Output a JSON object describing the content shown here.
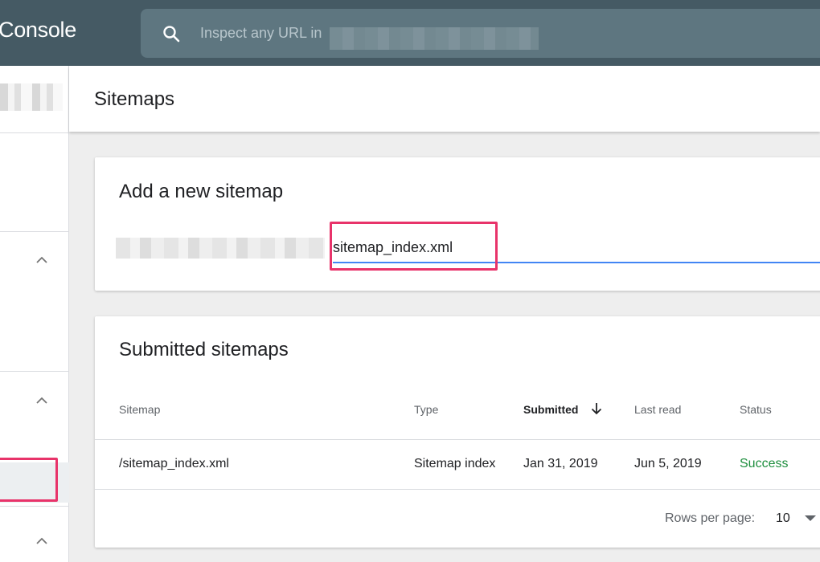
{
  "header": {
    "brand": "Console",
    "search_placeholder": "Inspect any URL in"
  },
  "page": {
    "title": "Sitemaps"
  },
  "add_sitemap": {
    "title": "Add a new sitemap",
    "input_value": "sitemap_index.xml"
  },
  "submitted": {
    "title": "Submitted sitemaps",
    "columns": {
      "sitemap": "Sitemap",
      "type": "Type",
      "submitted": "Submitted",
      "last_read": "Last read",
      "status": "Status"
    },
    "rows": [
      {
        "sitemap": "/sitemap_index.xml",
        "type": "Sitemap index",
        "submitted": "Jan 31, 2019",
        "last_read": "Jun 5, 2019",
        "status": "Success"
      }
    ],
    "footer": {
      "rows_per_page_label": "Rows per page:",
      "rows_per_page_value": "10"
    }
  },
  "colors": {
    "topbar": "#455a64",
    "accent_blue": "#4285f4",
    "success_green": "#1e8e3e",
    "highlight_pink": "#e8336a"
  },
  "icons": {
    "search": "search-icon",
    "chevron": "chevron-up-icon",
    "sort": "arrow-down-icon",
    "dropdown": "caret-down-icon"
  }
}
